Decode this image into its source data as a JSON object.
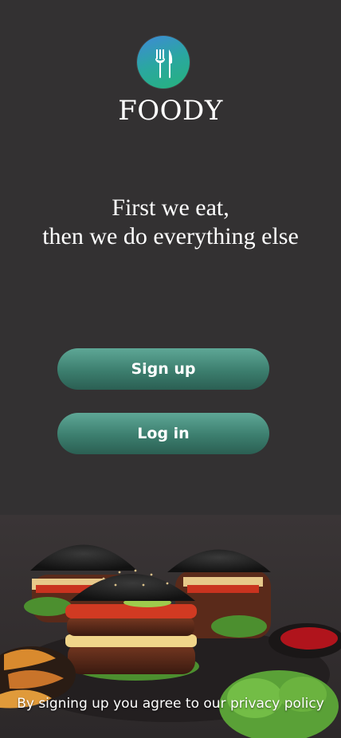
{
  "header": {
    "logo_icon": "fork-knife-icon",
    "brand_name": "FOODY"
  },
  "tagline": {
    "line1": "First we eat,",
    "line2": "then we do everything else"
  },
  "actions": {
    "signup_label": "Sign up",
    "login_label": "Log in"
  },
  "footer": {
    "privacy_prefix": "By signing up you agree to our ",
    "privacy_link": "privacy policy"
  },
  "colors": {
    "background": "#333132",
    "button": "#4a9281",
    "logo_gradient_start": "#3f89d8",
    "logo_gradient_end": "#27b27c"
  }
}
